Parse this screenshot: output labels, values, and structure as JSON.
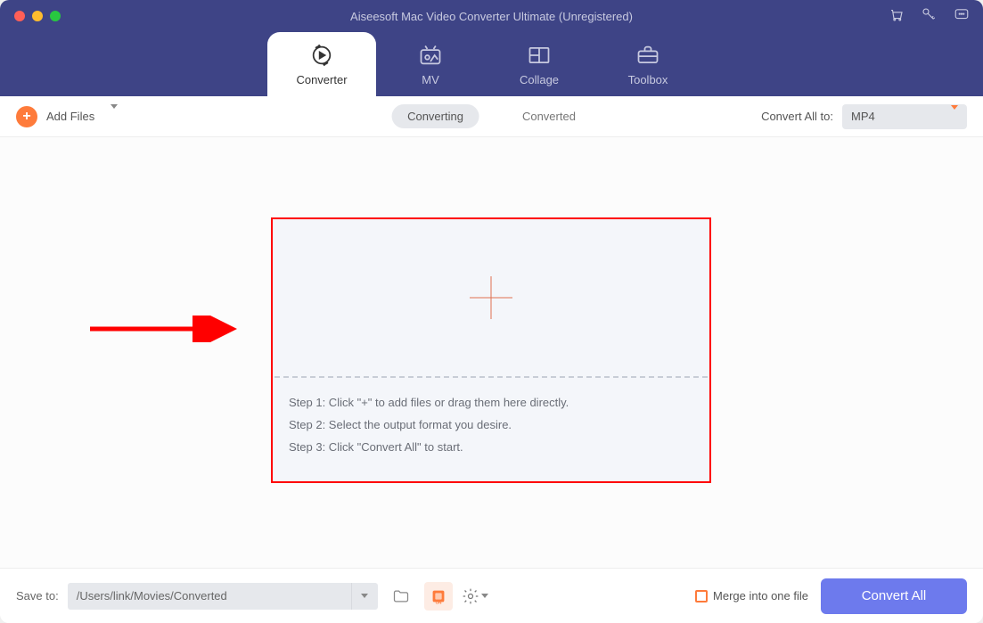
{
  "window": {
    "title": "Aiseesoft Mac Video Converter Ultimate (Unregistered)"
  },
  "tabs": [
    {
      "label": "Converter"
    },
    {
      "label": "MV"
    },
    {
      "label": "Collage"
    },
    {
      "label": "Toolbox"
    }
  ],
  "toolbar": {
    "add_files_label": "Add Files",
    "segments": {
      "converting": "Converting",
      "converted": "Converted"
    },
    "convert_all_to_label": "Convert All to:",
    "selected_format": "MP4"
  },
  "drop_zone": {
    "step1": "Step 1: Click \"+\" to add files or drag them here directly.",
    "step2": "Step 2: Select the output format you desire.",
    "step3": "Step 3: Click \"Convert All\" to start."
  },
  "bottombar": {
    "save_to_label": "Save to:",
    "save_path": "/Users/link/Movies/Converted",
    "merge_label": "Merge into one file",
    "convert_all_btn": "Convert All"
  },
  "colors": {
    "header_bg": "#3e4486",
    "accent_orange": "#fe7b3b",
    "primary_button": "#6d7aed",
    "annotation_red": "#ff0000"
  }
}
